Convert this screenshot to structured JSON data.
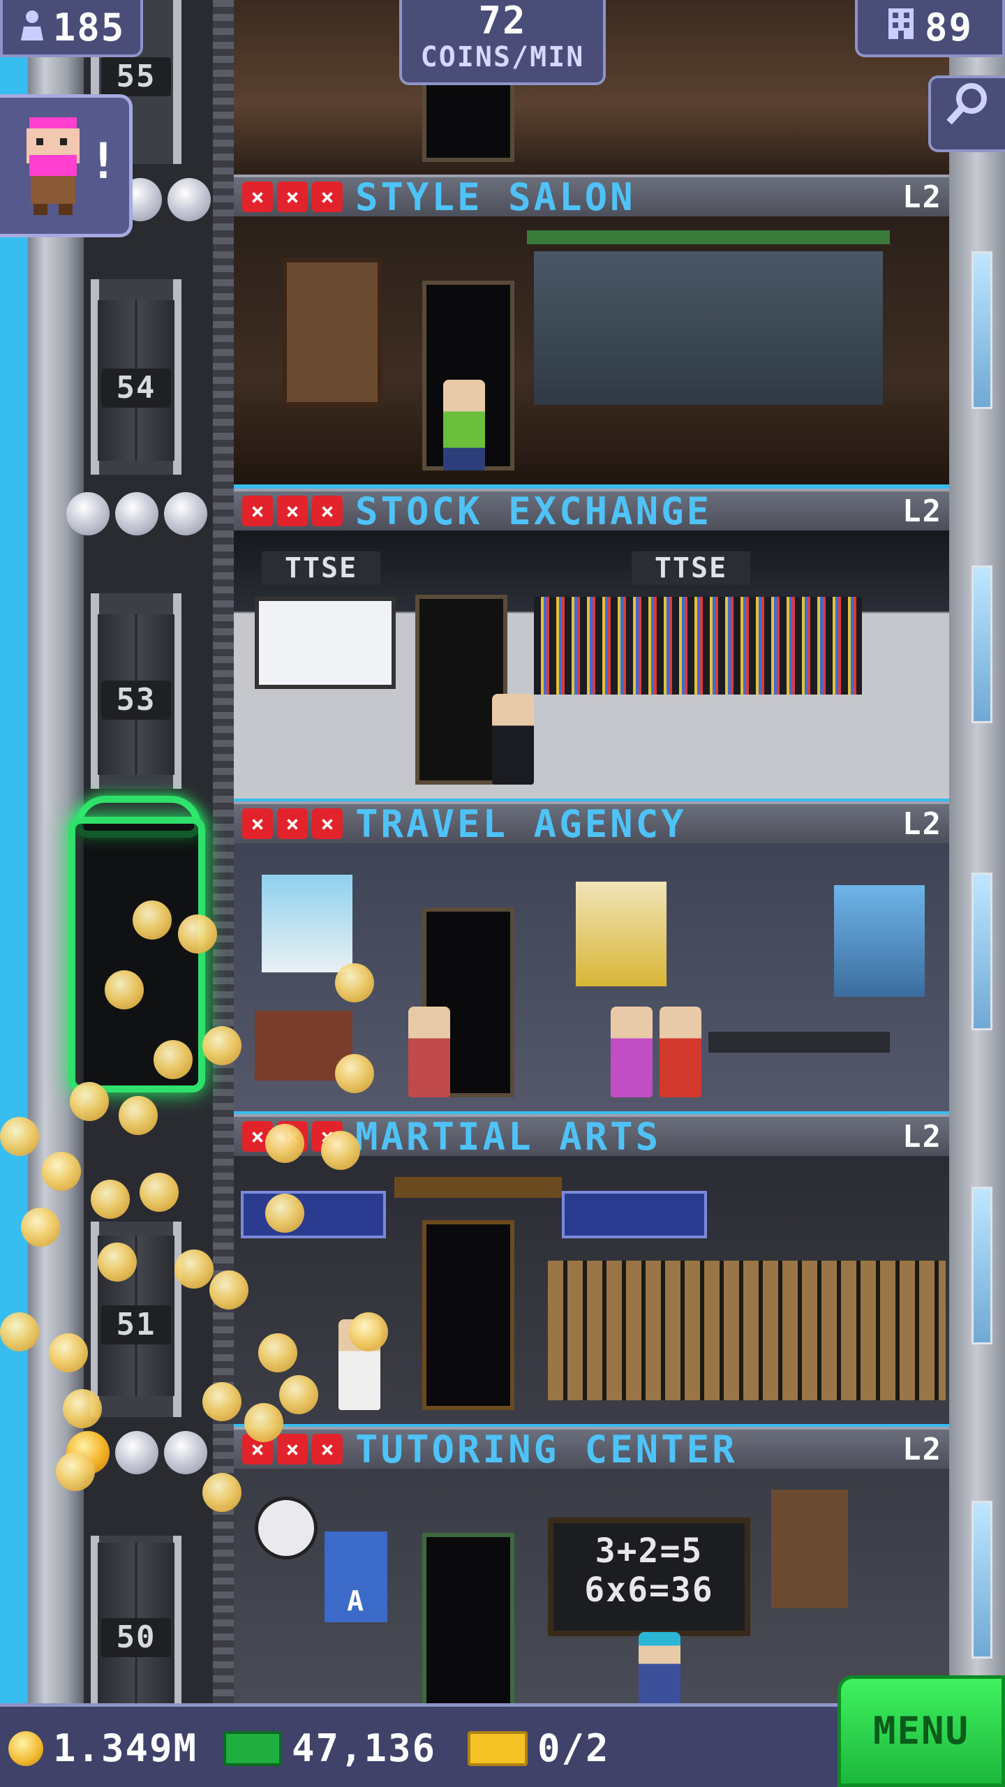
{
  "top_bar": {
    "population": "185",
    "coins_per_min_value": "72",
    "coins_per_min_unit": "COINS/MIN",
    "floor_count": "89"
  },
  "icons": {
    "population": "person-icon",
    "floors": "building-icon",
    "search": "magnifier-icon",
    "vip": "vip-visitor-avatar",
    "coin": "coin-icon",
    "bux": "tower-bux-icon",
    "ticket": "golden-ticket-icon"
  },
  "vip_alert": "!",
  "elevator": {
    "floor_numbers": [
      "55",
      "54",
      "53",
      "51",
      "50"
    ]
  },
  "floors": [
    {
      "name": "STYLE SALON",
      "level": "L2"
    },
    {
      "name": "STOCK EXCHANGE",
      "level": "L2",
      "sign_left": "TTSE",
      "sign_right": "TTSE"
    },
    {
      "name": "TRAVEL AGENCY",
      "level": "L2"
    },
    {
      "name": "MARTIAL ARTS",
      "level": "L2"
    },
    {
      "name": "TUTORING CENTER",
      "level": "L2",
      "chalkboard_line1": "3+2=5",
      "chalkboard_line2": "6x6=36",
      "poster_letter": "A"
    }
  ],
  "bottom_bar": {
    "coins": "1.349M",
    "bux": "47,136",
    "tickets": "0/2",
    "menu_label": "MENU"
  },
  "colors": {
    "sky": "#38bdf1",
    "floor_name": "#4fc3f7",
    "stock_marker": "#e2232c",
    "menu_green": "#2ad14a",
    "vip_glow": "#2fe06a"
  }
}
